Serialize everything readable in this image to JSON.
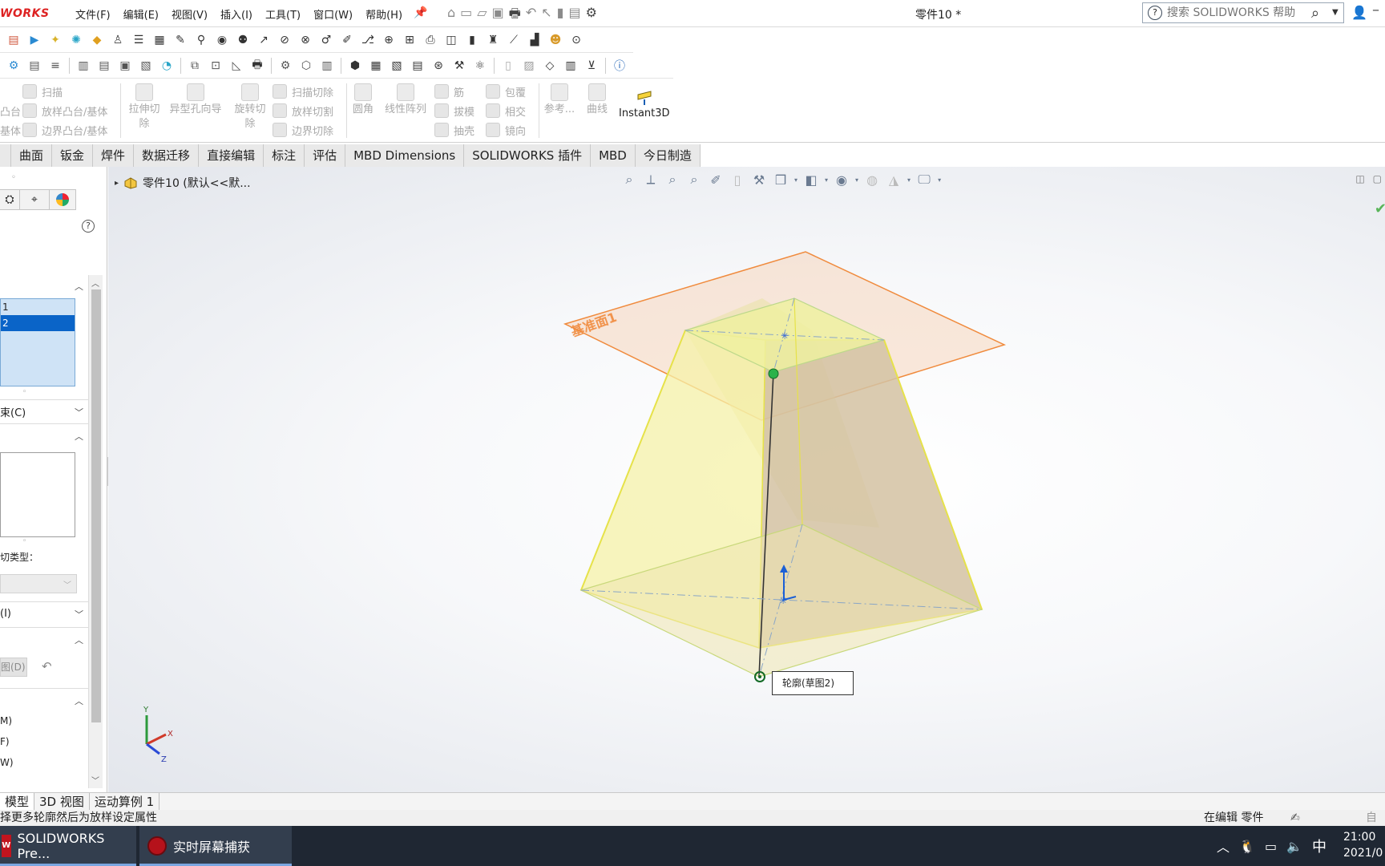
{
  "app": {
    "brand": "WORKS",
    "document_title": "零件10 *",
    "menus": [
      "文件(F)",
      "编辑(E)",
      "视图(V)",
      "插入(I)",
      "工具(T)",
      "窗口(W)",
      "帮助(H)"
    ],
    "search_placeholder": "搜索 SOLIDWORKS 帮助"
  },
  "command_manager": {
    "boss_col": [
      "扫描",
      "放样凸台/基体",
      "边界凸台/基体"
    ],
    "boss_partial": [
      "凸台",
      "基体"
    ],
    "extrude_cut": "拉伸切除",
    "hole_wizard": "异型孔向导",
    "revolve_cut": "旋转切除",
    "cut_col": [
      "扫描切除",
      "放样切割",
      "边界切除"
    ],
    "fillet": "圆角",
    "linear_pattern": "线性阵列",
    "rib_col": [
      "筋",
      "拔模",
      "抽壳"
    ],
    "wrap_col": [
      "包覆",
      "相交",
      "镜向"
    ],
    "reference": "参考...",
    "curves": "曲线",
    "instant3d": "Instant3D"
  },
  "tabs": [
    "",
    "曲面",
    "钣金",
    "焊件",
    "数据迁移",
    "直接编辑",
    "标注",
    "评估",
    "MBD Dimensions",
    "SOLIDWORKS 插件",
    "MBD",
    "今日制造"
  ],
  "property_manager": {
    "profiles": [
      "1",
      "2"
    ],
    "section_constraints": "束(C)",
    "cut_type_label": "切类型：",
    "section_i": "(I)",
    "btn_partial": "图(D)",
    "opts": [
      "M)",
      "F)",
      "W)"
    ]
  },
  "viewport": {
    "tree_label": "零件10 (默认<<默...",
    "plane_label": "基准面1",
    "tooltip": "轮廓(草图2)",
    "triad": {
      "x": "X",
      "y": "Y",
      "z": "Z"
    }
  },
  "bottom_tabs": [
    "模型",
    "3D 视图",
    "运动算例 1"
  ],
  "status": {
    "left": "择更多轮廓然后为放样设定属性",
    "right": "在编辑 零件",
    "far": "自"
  },
  "taskbar": {
    "items": [
      "SOLIDWORKS Pre...",
      "实时屏幕捕获"
    ],
    "ime": "中",
    "time": "21:00",
    "date": "2021/0"
  },
  "colors": {
    "accent": "#0a64c8",
    "plane": "#f08a3c",
    "solid_face": "#f4f0a0",
    "solid_edge": "#e6e24a",
    "brand": "#d22222"
  }
}
